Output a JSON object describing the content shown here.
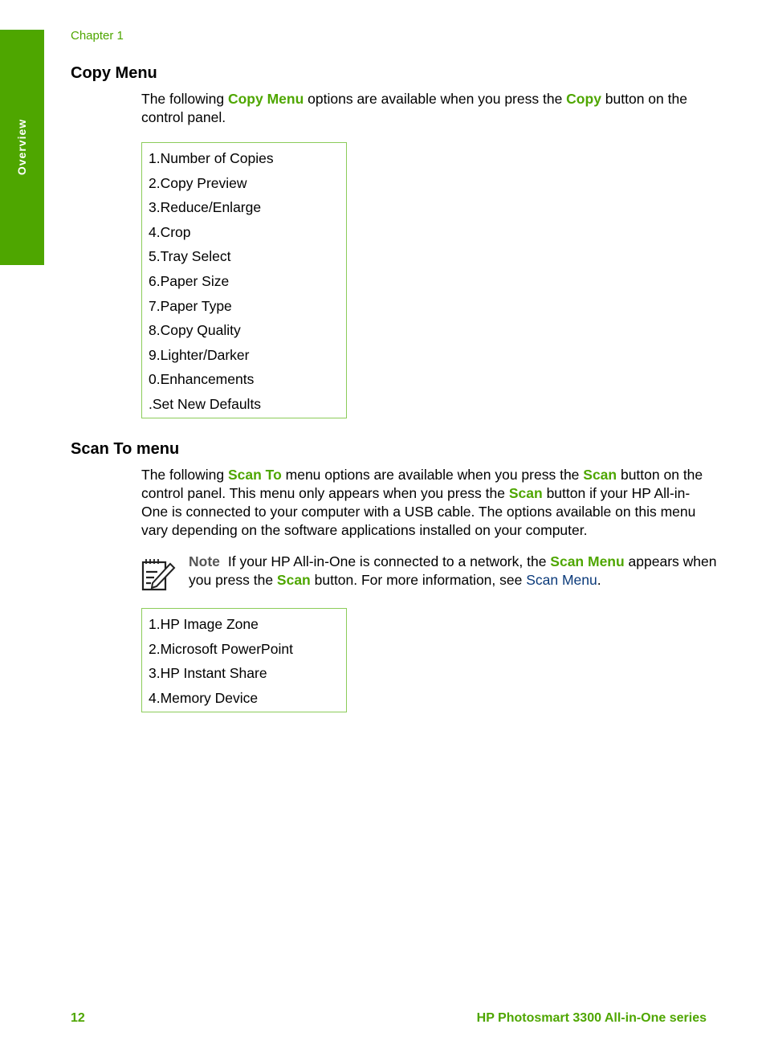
{
  "side_tab": {
    "label": "Overview",
    "color": "#4ea600"
  },
  "header": {
    "chapter": "Chapter 1"
  },
  "copy_section": {
    "heading": "Copy Menu",
    "intro": {
      "t1": "The following ",
      "h1": "Copy Menu",
      "t2": " options are available when you press the ",
      "h2": "Copy",
      "t3": " button on the control panel."
    },
    "items": [
      "1.Number of Copies",
      "2.Copy Preview",
      "3.Reduce/Enlarge",
      "4.Crop",
      "5.Tray Select",
      "6.Paper Size",
      "7.Paper Type",
      "8.Copy Quality",
      "9.Lighter/Darker",
      "0.Enhancements",
      ".Set New Defaults"
    ]
  },
  "scan_section": {
    "heading": "Scan To menu",
    "intro": {
      "t1": "The following ",
      "h1": "Scan To",
      "t2": " menu options are available when you press the ",
      "h2": "Scan",
      "t3": " button on the control panel. This menu only appears when you press the ",
      "h3": "Scan",
      "t4": " button if your HP All-in-One is connected to your computer with a USB cable. The options available on this menu vary depending on the software applications installed on your computer."
    },
    "note": {
      "icon": "note-pencil-icon",
      "label": "Note",
      "t1": "If your HP All-in-One is connected to a network, the ",
      "h1": "Scan Menu",
      "t2": " appears when you press the ",
      "h2": "Scan",
      "t3": " button. For more information, see ",
      "link": "Scan Menu",
      "t4": "."
    },
    "items": [
      "1.HP Image Zone",
      "2.Microsoft PowerPoint",
      "3.HP Instant Share",
      "4.Memory Device"
    ]
  },
  "footer": {
    "page_number": "12",
    "title": "HP Photosmart 3300 All-in-One series"
  },
  "colors": {
    "accent": "#4ea600",
    "box_border": "#8ccc5a",
    "link": "#0b3a7a"
  }
}
